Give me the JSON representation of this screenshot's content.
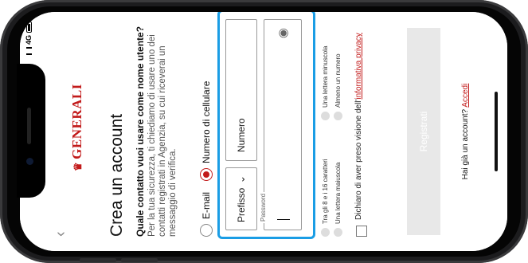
{
  "status_bar": {
    "network": "4G"
  },
  "header": {
    "back_icon": "chevron-left-icon",
    "logo_text": "GENERALI",
    "logo_icon": "lion-icon"
  },
  "page": {
    "title": "Crea un account",
    "question": "Quale contatto vuoi usare come nome utente?",
    "explanation": "Per la tua sicurezza, ti chiediamo di usare uno dei contatti registrati in Agenzia, su cui riceverai un messaggio di verifica."
  },
  "contact_options": [
    {
      "label": "E-mail",
      "selected": false
    },
    {
      "label": "Numero di cellulare",
      "selected": true
    }
  ],
  "phone": {
    "prefix_label": "Prefisso",
    "prefix_chevron": "chevron-down-icon",
    "number_placeholder": "Numero"
  },
  "password": {
    "label": "Password",
    "value": "",
    "toggle_icon": "eye-icon"
  },
  "password_rules": [
    "Tra gli 8 e i 16 caratteri",
    "Una lettera minuscola",
    "Una lettera maiuscola",
    "Almeno un numero"
  ],
  "consent": {
    "text": "Dichiaro di aver preso visione dell'",
    "link": "informativa privacy"
  },
  "register_button": "Registrati",
  "login": {
    "text": "Hai già un account?",
    "link": "Accedi"
  },
  "colors": {
    "accent": "#c21a1a",
    "highlight": "#1a9de5"
  }
}
